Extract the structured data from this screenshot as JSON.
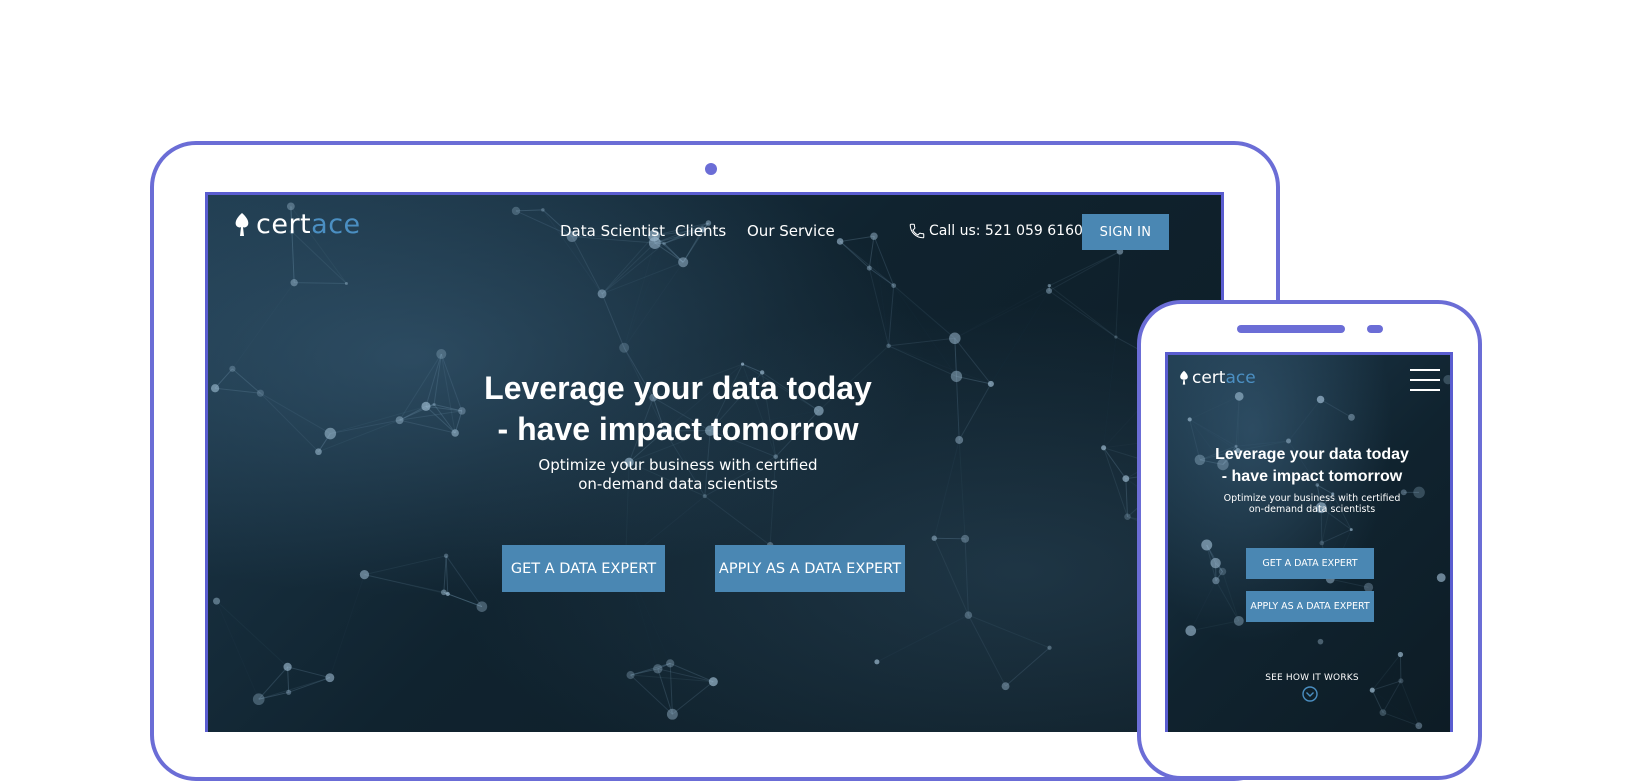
{
  "brand": {
    "name_part1": "cert",
    "name_part2": "ace",
    "accent": "#4b8fc2"
  },
  "frame_color": "#6b6dd6",
  "desktop": {
    "nav": [
      {
        "label": "Data Scientist"
      },
      {
        "label": "Clients"
      },
      {
        "label": "Our Service"
      }
    ],
    "phone": {
      "label": "Call us: 521 059 6160",
      "icon": "phone-icon"
    },
    "signin_label": "SIGN IN",
    "hero": {
      "title_line1": "Leverage your data today",
      "title_line2": "- have impact tomorrow",
      "subtitle_line1": "Optimize your business with certified",
      "subtitle_line2": "on-demand data scientists"
    },
    "buttons": {
      "get_expert": "GET A DATA EXPERT",
      "apply_expert": "APPLY AS A DATA EXPERT"
    }
  },
  "mobile": {
    "menu_icon": "hamburger-icon",
    "hero": {
      "title_line1": "Leverage your data today",
      "title_line2": "- have impact tomorrow",
      "subtitle_line1": "Optimize your business with certified",
      "subtitle_line2": "on-demand data scientists"
    },
    "buttons": {
      "get_expert": "GET A DATA EXPERT",
      "apply_expert": "APPLY AS A DATA EXPERT"
    },
    "see_how": "SEE HOW IT WORKS"
  },
  "colors": {
    "button": "#4a87b3",
    "screen_bg": "#10232f"
  }
}
